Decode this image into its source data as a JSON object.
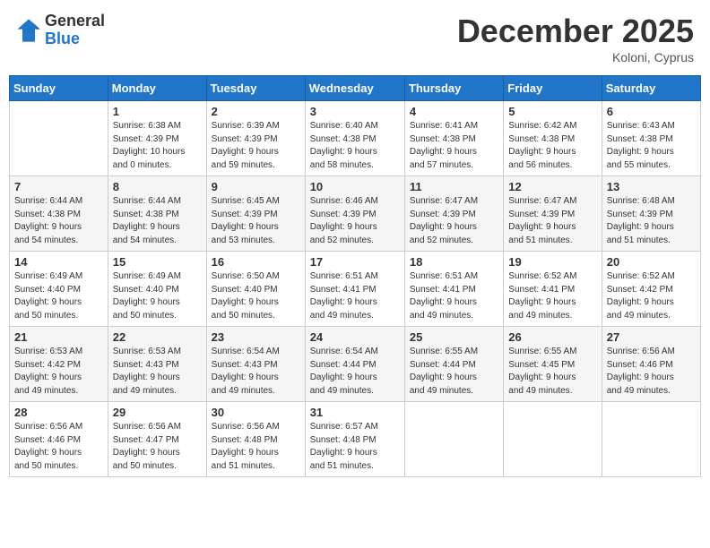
{
  "header": {
    "logo_general": "General",
    "logo_blue": "Blue",
    "month_title": "December 2025",
    "subtitle": "Koloni, Cyprus"
  },
  "weekdays": [
    "Sunday",
    "Monday",
    "Tuesday",
    "Wednesday",
    "Thursday",
    "Friday",
    "Saturday"
  ],
  "weeks": [
    [
      {
        "day": "",
        "info": ""
      },
      {
        "day": "1",
        "info": "Sunrise: 6:38 AM\nSunset: 4:39 PM\nDaylight: 10 hours\nand 0 minutes."
      },
      {
        "day": "2",
        "info": "Sunrise: 6:39 AM\nSunset: 4:39 PM\nDaylight: 9 hours\nand 59 minutes."
      },
      {
        "day": "3",
        "info": "Sunrise: 6:40 AM\nSunset: 4:38 PM\nDaylight: 9 hours\nand 58 minutes."
      },
      {
        "day": "4",
        "info": "Sunrise: 6:41 AM\nSunset: 4:38 PM\nDaylight: 9 hours\nand 57 minutes."
      },
      {
        "day": "5",
        "info": "Sunrise: 6:42 AM\nSunset: 4:38 PM\nDaylight: 9 hours\nand 56 minutes."
      },
      {
        "day": "6",
        "info": "Sunrise: 6:43 AM\nSunset: 4:38 PM\nDaylight: 9 hours\nand 55 minutes."
      }
    ],
    [
      {
        "day": "7",
        "info": "Sunrise: 6:44 AM\nSunset: 4:38 PM\nDaylight: 9 hours\nand 54 minutes."
      },
      {
        "day": "8",
        "info": "Sunrise: 6:44 AM\nSunset: 4:38 PM\nDaylight: 9 hours\nand 54 minutes."
      },
      {
        "day": "9",
        "info": "Sunrise: 6:45 AM\nSunset: 4:39 PM\nDaylight: 9 hours\nand 53 minutes."
      },
      {
        "day": "10",
        "info": "Sunrise: 6:46 AM\nSunset: 4:39 PM\nDaylight: 9 hours\nand 52 minutes."
      },
      {
        "day": "11",
        "info": "Sunrise: 6:47 AM\nSunset: 4:39 PM\nDaylight: 9 hours\nand 52 minutes."
      },
      {
        "day": "12",
        "info": "Sunrise: 6:47 AM\nSunset: 4:39 PM\nDaylight: 9 hours\nand 51 minutes."
      },
      {
        "day": "13",
        "info": "Sunrise: 6:48 AM\nSunset: 4:39 PM\nDaylight: 9 hours\nand 51 minutes."
      }
    ],
    [
      {
        "day": "14",
        "info": "Sunrise: 6:49 AM\nSunset: 4:40 PM\nDaylight: 9 hours\nand 50 minutes."
      },
      {
        "day": "15",
        "info": "Sunrise: 6:49 AM\nSunset: 4:40 PM\nDaylight: 9 hours\nand 50 minutes."
      },
      {
        "day": "16",
        "info": "Sunrise: 6:50 AM\nSunset: 4:40 PM\nDaylight: 9 hours\nand 50 minutes."
      },
      {
        "day": "17",
        "info": "Sunrise: 6:51 AM\nSunset: 4:41 PM\nDaylight: 9 hours\nand 49 minutes."
      },
      {
        "day": "18",
        "info": "Sunrise: 6:51 AM\nSunset: 4:41 PM\nDaylight: 9 hours\nand 49 minutes."
      },
      {
        "day": "19",
        "info": "Sunrise: 6:52 AM\nSunset: 4:41 PM\nDaylight: 9 hours\nand 49 minutes."
      },
      {
        "day": "20",
        "info": "Sunrise: 6:52 AM\nSunset: 4:42 PM\nDaylight: 9 hours\nand 49 minutes."
      }
    ],
    [
      {
        "day": "21",
        "info": "Sunrise: 6:53 AM\nSunset: 4:42 PM\nDaylight: 9 hours\nand 49 minutes."
      },
      {
        "day": "22",
        "info": "Sunrise: 6:53 AM\nSunset: 4:43 PM\nDaylight: 9 hours\nand 49 minutes."
      },
      {
        "day": "23",
        "info": "Sunrise: 6:54 AM\nSunset: 4:43 PM\nDaylight: 9 hours\nand 49 minutes."
      },
      {
        "day": "24",
        "info": "Sunrise: 6:54 AM\nSunset: 4:44 PM\nDaylight: 9 hours\nand 49 minutes."
      },
      {
        "day": "25",
        "info": "Sunrise: 6:55 AM\nSunset: 4:44 PM\nDaylight: 9 hours\nand 49 minutes."
      },
      {
        "day": "26",
        "info": "Sunrise: 6:55 AM\nSunset: 4:45 PM\nDaylight: 9 hours\nand 49 minutes."
      },
      {
        "day": "27",
        "info": "Sunrise: 6:56 AM\nSunset: 4:46 PM\nDaylight: 9 hours\nand 49 minutes."
      }
    ],
    [
      {
        "day": "28",
        "info": "Sunrise: 6:56 AM\nSunset: 4:46 PM\nDaylight: 9 hours\nand 50 minutes."
      },
      {
        "day": "29",
        "info": "Sunrise: 6:56 AM\nSunset: 4:47 PM\nDaylight: 9 hours\nand 50 minutes."
      },
      {
        "day": "30",
        "info": "Sunrise: 6:56 AM\nSunset: 4:48 PM\nDaylight: 9 hours\nand 51 minutes."
      },
      {
        "day": "31",
        "info": "Sunrise: 6:57 AM\nSunset: 4:48 PM\nDaylight: 9 hours\nand 51 minutes."
      },
      {
        "day": "",
        "info": ""
      },
      {
        "day": "",
        "info": ""
      },
      {
        "day": "",
        "info": ""
      }
    ]
  ]
}
